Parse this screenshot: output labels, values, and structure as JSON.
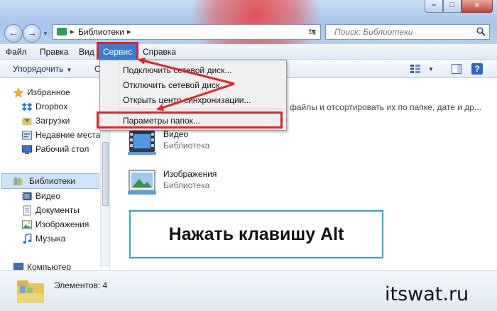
{
  "address": {
    "crumb": "Библиотеки"
  },
  "search": {
    "placeholder": "Поиск: Библиотеки"
  },
  "menubar": {
    "items": [
      "Файл",
      "Правка",
      "Вид",
      "Сервис",
      "Справка"
    ],
    "active": "Сервис"
  },
  "toolbar": {
    "organize": "Упорядочить",
    "cut_letter": "С"
  },
  "sidebar": {
    "items": [
      {
        "label": "Избранное",
        "icon": "star-icon"
      },
      {
        "label": "Dropbox",
        "icon": "dropbox-icon"
      },
      {
        "label": "Загрузки",
        "icon": "downloads-icon"
      },
      {
        "label": "Недавние места",
        "icon": "recent-places-icon"
      },
      {
        "label": "Рабочий стол",
        "icon": "desktop-icon"
      },
      {
        "label": "Библиотеки",
        "icon": "libraries-icon"
      },
      {
        "label": "Видео",
        "icon": "video-icon"
      },
      {
        "label": "Документы",
        "icon": "documents-icon"
      },
      {
        "label": "Изображения",
        "icon": "pictures-icon"
      },
      {
        "label": "Музыка",
        "icon": "music-icon"
      },
      {
        "label": "Компьютер",
        "icon": "computer-icon"
      }
    ]
  },
  "dropdown": {
    "items": [
      "Подключить сетевой диск...",
      "Отключить сетевой диск...",
      "Открыть центр синхронизации...",
      "Параметры папок..."
    ],
    "highlighted": "Параметры папок..."
  },
  "main": {
    "hint": "файлы и отсортировать их по папке, дате и др...",
    "libraries": [
      {
        "name": "Видео",
        "type": "Библиотека",
        "icon": "video-library-icon"
      },
      {
        "name": "Изображения",
        "type": "Библиотека",
        "icon": "pictures-library-icon"
      }
    ]
  },
  "callout": {
    "text": "Нажать клавишу Alt"
  },
  "status": {
    "items_count": "Элементов: 4"
  },
  "watermark": "itswat.ru",
  "colors": {
    "accent_red": "#d9262b",
    "menu_active": "#3b7cd3",
    "callout_border": "#2ea6c9"
  }
}
